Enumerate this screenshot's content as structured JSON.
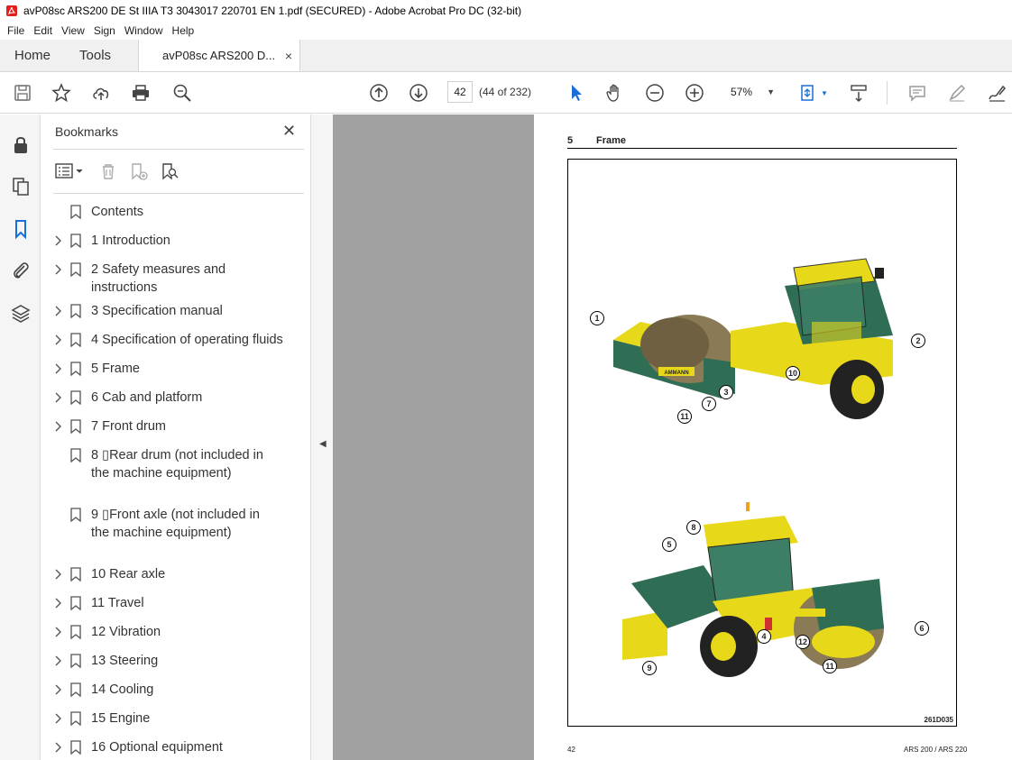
{
  "window": {
    "title": "avP08sc ARS200 DE St IIIA T3 3043017 220701 EN 1.pdf (SECURED) - Adobe Acrobat Pro DC (32-bit)"
  },
  "menu": [
    "File",
    "Edit",
    "View",
    "Sign",
    "Window",
    "Help"
  ],
  "tabs": {
    "home": "Home",
    "tools": "Tools",
    "doc": "avP08sc ARS200 D...",
    "close": "×"
  },
  "toolbar": {
    "page_current": "42",
    "page_count": "(44 of 232)",
    "zoom": "57%"
  },
  "bookmarks": {
    "title": "Bookmarks",
    "close": "✕",
    "items": [
      {
        "label": "Contents",
        "expandable": false
      },
      {
        "label": "1 Introduction",
        "expandable": true
      },
      {
        "label": "2 Safety measures and instructions",
        "expandable": true
      },
      {
        "label": "3 Specification manual",
        "expandable": true
      },
      {
        "label": "4 Specification of operating fluids",
        "expandable": true
      },
      {
        "label": "5 Frame",
        "expandable": true
      },
      {
        "label": "6 Cab and platform",
        "expandable": true
      },
      {
        "label": "7 Front drum",
        "expandable": true
      },
      {
        "label": "8 ▯Rear drum (not included in the machine equipment)",
        "expandable": false
      },
      {
        "label": "9 ▯Front axle (not included in the machine equipment)",
        "expandable": false
      },
      {
        "label": "10 Rear axle",
        "expandable": true
      },
      {
        "label": "11 Travel",
        "expandable": true
      },
      {
        "label": "12 Vibration",
        "expandable": true
      },
      {
        "label": "13 Steering",
        "expandable": true
      },
      {
        "label": "14 Cooling",
        "expandable": true
      },
      {
        "label": "15 Engine",
        "expandable": true
      },
      {
        "label": "16 Optional equipment",
        "expandable": true
      }
    ]
  },
  "document": {
    "section_number": "5",
    "section_title": "Frame",
    "figure_code": "261D035",
    "page_number": "42",
    "model": "ARS 200 / ARS 220",
    "brand": "AMMANN",
    "callouts": [
      "1",
      "2",
      "3",
      "7",
      "10",
      "11",
      "5",
      "8",
      "6",
      "4",
      "12",
      "9",
      "11"
    ]
  },
  "colors": {
    "machine_yellow": "#e8d81a",
    "machine_green": "#2f6e55",
    "viewer_gray": "#a1a1a1",
    "accent_blue": "#1a6fd6"
  }
}
